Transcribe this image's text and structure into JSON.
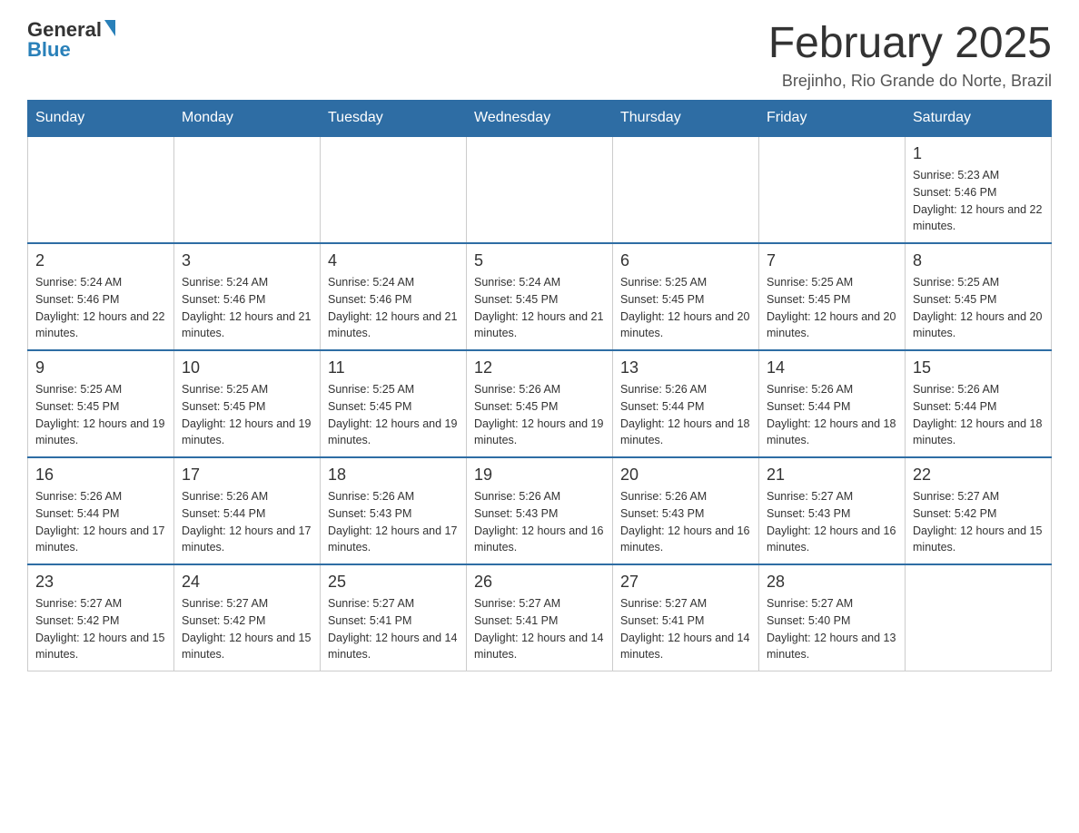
{
  "header": {
    "logo": {
      "general": "General",
      "blue": "Blue"
    },
    "title": "February 2025",
    "location": "Brejinho, Rio Grande do Norte, Brazil"
  },
  "weekdays": [
    "Sunday",
    "Monday",
    "Tuesday",
    "Wednesday",
    "Thursday",
    "Friday",
    "Saturday"
  ],
  "weeks": [
    [
      {
        "day": "",
        "info": ""
      },
      {
        "day": "",
        "info": ""
      },
      {
        "day": "",
        "info": ""
      },
      {
        "day": "",
        "info": ""
      },
      {
        "day": "",
        "info": ""
      },
      {
        "day": "",
        "info": ""
      },
      {
        "day": "1",
        "info": "Sunrise: 5:23 AM\nSunset: 5:46 PM\nDaylight: 12 hours and 22 minutes."
      }
    ],
    [
      {
        "day": "2",
        "info": "Sunrise: 5:24 AM\nSunset: 5:46 PM\nDaylight: 12 hours and 22 minutes."
      },
      {
        "day": "3",
        "info": "Sunrise: 5:24 AM\nSunset: 5:46 PM\nDaylight: 12 hours and 21 minutes."
      },
      {
        "day": "4",
        "info": "Sunrise: 5:24 AM\nSunset: 5:46 PM\nDaylight: 12 hours and 21 minutes."
      },
      {
        "day": "5",
        "info": "Sunrise: 5:24 AM\nSunset: 5:45 PM\nDaylight: 12 hours and 21 minutes."
      },
      {
        "day": "6",
        "info": "Sunrise: 5:25 AM\nSunset: 5:45 PM\nDaylight: 12 hours and 20 minutes."
      },
      {
        "day": "7",
        "info": "Sunrise: 5:25 AM\nSunset: 5:45 PM\nDaylight: 12 hours and 20 minutes."
      },
      {
        "day": "8",
        "info": "Sunrise: 5:25 AM\nSunset: 5:45 PM\nDaylight: 12 hours and 20 minutes."
      }
    ],
    [
      {
        "day": "9",
        "info": "Sunrise: 5:25 AM\nSunset: 5:45 PM\nDaylight: 12 hours and 19 minutes."
      },
      {
        "day": "10",
        "info": "Sunrise: 5:25 AM\nSunset: 5:45 PM\nDaylight: 12 hours and 19 minutes."
      },
      {
        "day": "11",
        "info": "Sunrise: 5:25 AM\nSunset: 5:45 PM\nDaylight: 12 hours and 19 minutes."
      },
      {
        "day": "12",
        "info": "Sunrise: 5:26 AM\nSunset: 5:45 PM\nDaylight: 12 hours and 19 minutes."
      },
      {
        "day": "13",
        "info": "Sunrise: 5:26 AM\nSunset: 5:44 PM\nDaylight: 12 hours and 18 minutes."
      },
      {
        "day": "14",
        "info": "Sunrise: 5:26 AM\nSunset: 5:44 PM\nDaylight: 12 hours and 18 minutes."
      },
      {
        "day": "15",
        "info": "Sunrise: 5:26 AM\nSunset: 5:44 PM\nDaylight: 12 hours and 18 minutes."
      }
    ],
    [
      {
        "day": "16",
        "info": "Sunrise: 5:26 AM\nSunset: 5:44 PM\nDaylight: 12 hours and 17 minutes."
      },
      {
        "day": "17",
        "info": "Sunrise: 5:26 AM\nSunset: 5:44 PM\nDaylight: 12 hours and 17 minutes."
      },
      {
        "day": "18",
        "info": "Sunrise: 5:26 AM\nSunset: 5:43 PM\nDaylight: 12 hours and 17 minutes."
      },
      {
        "day": "19",
        "info": "Sunrise: 5:26 AM\nSunset: 5:43 PM\nDaylight: 12 hours and 16 minutes."
      },
      {
        "day": "20",
        "info": "Sunrise: 5:26 AM\nSunset: 5:43 PM\nDaylight: 12 hours and 16 minutes."
      },
      {
        "day": "21",
        "info": "Sunrise: 5:27 AM\nSunset: 5:43 PM\nDaylight: 12 hours and 16 minutes."
      },
      {
        "day": "22",
        "info": "Sunrise: 5:27 AM\nSunset: 5:42 PM\nDaylight: 12 hours and 15 minutes."
      }
    ],
    [
      {
        "day": "23",
        "info": "Sunrise: 5:27 AM\nSunset: 5:42 PM\nDaylight: 12 hours and 15 minutes."
      },
      {
        "day": "24",
        "info": "Sunrise: 5:27 AM\nSunset: 5:42 PM\nDaylight: 12 hours and 15 minutes."
      },
      {
        "day": "25",
        "info": "Sunrise: 5:27 AM\nSunset: 5:41 PM\nDaylight: 12 hours and 14 minutes."
      },
      {
        "day": "26",
        "info": "Sunrise: 5:27 AM\nSunset: 5:41 PM\nDaylight: 12 hours and 14 minutes."
      },
      {
        "day": "27",
        "info": "Sunrise: 5:27 AM\nSunset: 5:41 PM\nDaylight: 12 hours and 14 minutes."
      },
      {
        "day": "28",
        "info": "Sunrise: 5:27 AM\nSunset: 5:40 PM\nDaylight: 12 hours and 13 minutes."
      },
      {
        "day": "",
        "info": ""
      }
    ]
  ]
}
